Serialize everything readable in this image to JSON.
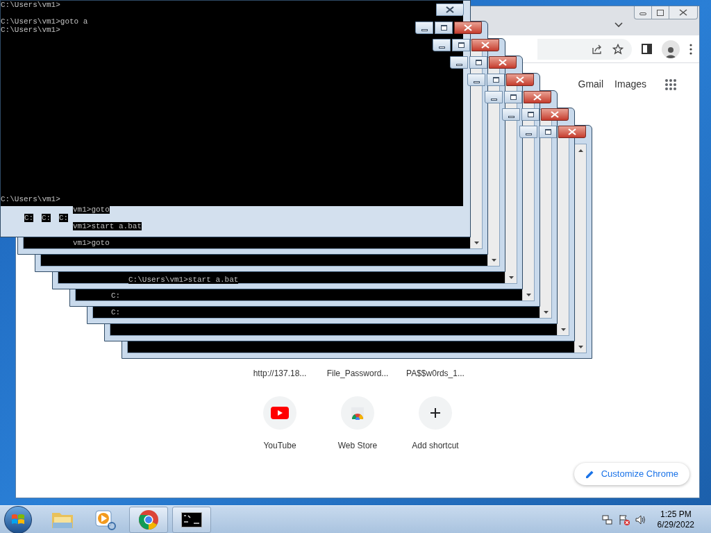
{
  "console": {
    "top_lines": [
      "C:\\Users\\vm1>",
      "C:\\Users\\vm1>goto a",
      "C:\\Users\\vm1>"
    ],
    "bottom_line": "C:\\Users\\vm1>"
  },
  "ghost_texts": [
    "C:",
    "C:",
    "C:",
    "vm1>goto",
    "vm1>start a.bat",
    "vm1>goto",
    "C:\\Users\\vm1>start a.bat",
    "C:",
    "C:"
  ],
  "chrome": {
    "header_links": [
      "Gmail",
      "Images"
    ],
    "shortcut_titles": [
      "http://137.18...",
      "File_Password...",
      "PA$$w0rds_1..."
    ],
    "shortcuts": [
      {
        "kind": "youtube",
        "label": "YouTube"
      },
      {
        "kind": "webstore",
        "label": "Web Store"
      },
      {
        "kind": "add",
        "label": "Add shortcut"
      }
    ],
    "customize": "Customize Chrome"
  },
  "taskbar": {
    "items": [
      {
        "kind": "explorer",
        "open": false
      },
      {
        "kind": "media",
        "open": false
      },
      {
        "kind": "chrome",
        "open": true
      },
      {
        "kind": "cmd",
        "open": true
      }
    ],
    "time": "1:25 PM",
    "date": "6/29/2022"
  }
}
